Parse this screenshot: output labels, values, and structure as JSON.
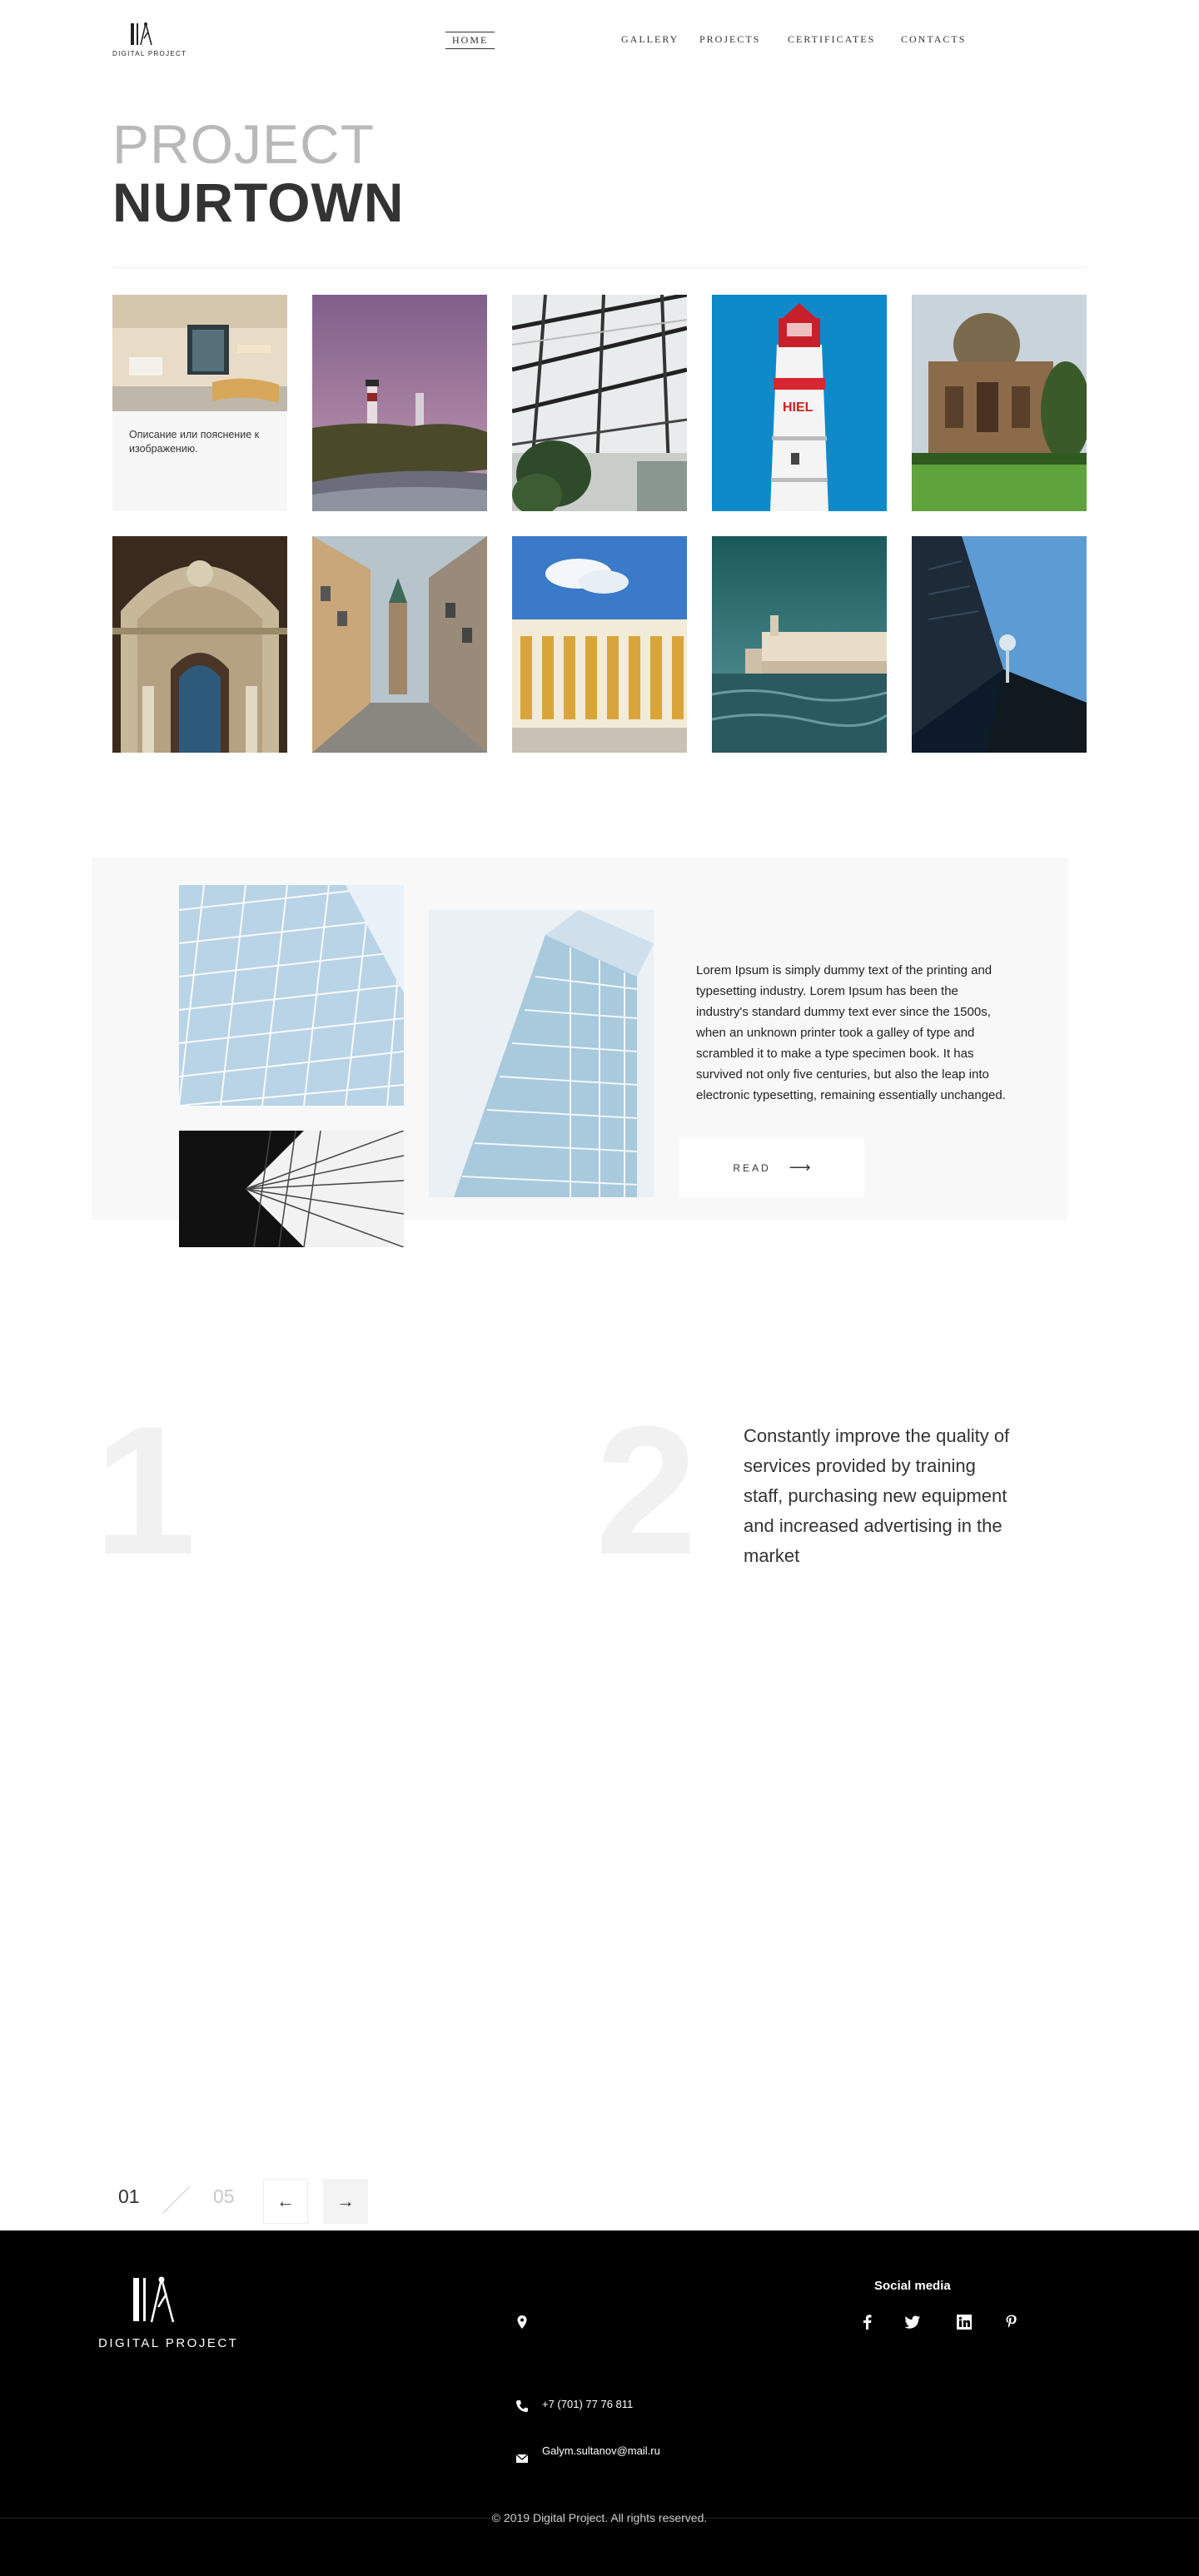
{
  "header": {
    "logo_text": "DIGITAL PROJECT",
    "nav": [
      {
        "label": "HOME",
        "active": true
      },
      {
        "label": "GALLERY",
        "active": false
      },
      {
        "label": "PROJECTS",
        "active": false
      },
      {
        "label": "CERTIFICATES",
        "active": false
      },
      {
        "label": "CONTACTS",
        "active": false
      }
    ]
  },
  "title": {
    "line1": "PROJECT",
    "line2": "NURTOWN"
  },
  "gallery": {
    "caption": "Описание или пояснение к изображению.",
    "tiles": [
      "lobby-photo",
      "lighthouse-coast-photo",
      "glass-roof-photo",
      "lighthouse-tower-photo",
      "tomb-photo",
      "arch-interior-photo",
      "street-photo",
      "colonnade-photo",
      "venice-photo",
      "skyscraper-photo"
    ]
  },
  "feature": {
    "text": "Lorem Ipsum is simply dummy text of the printing and typesetting industry. Lorem Ipsum has been the industry's standard dummy text ever since the 1500s, when an unknown printer took a galley of type and scrambled it to make a type specimen book. It has survived not only five centuries, but also the leap into electronic typesetting, remaining essentially unchanged.",
    "read_label": "READ",
    "read_icon": "arrow-right-icon"
  },
  "numbers": {
    "n1": "1",
    "n2": "2",
    "text2": "Constantly improve the quality of services provided by training staff, purchasing new equipment and increased advertising in the market"
  },
  "pagination": {
    "current": "01",
    "total": "05",
    "prev_icon": "←",
    "next_icon": "→"
  },
  "footer": {
    "logo_text": "DIGITAL PROJECT",
    "phone": "+7 (701) 77 76 811",
    "email": "Galym.sultanov@mail.ru",
    "social_title": "Social media",
    "social": [
      "facebook-icon",
      "twitter-icon",
      "linkedin-icon",
      "pinterest-icon"
    ],
    "copyright": "© 2019 Digital Project. All rights reserved."
  },
  "colors": {
    "accent": "#333333",
    "footer_bg": "#000000",
    "muted_title": "#b9b9b9"
  }
}
